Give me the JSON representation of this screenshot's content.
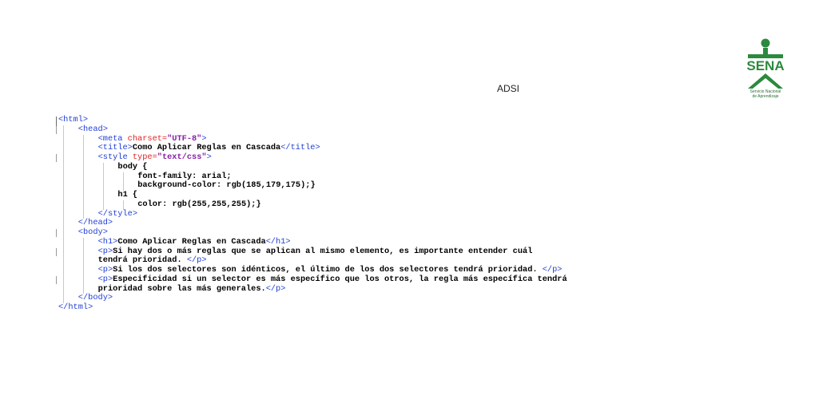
{
  "header": {
    "label": "ADSI",
    "logo": {
      "wordmark": "SENA",
      "subtitle_line1": "Servicio Nacional",
      "subtitle_line2": "de Aprendizaje",
      "color": "#2b8a3e"
    }
  },
  "colors": {
    "tag": "#1f3ed4",
    "attribute": "#e02020",
    "value": "#8a1fa8",
    "text": "#000000"
  },
  "code_lines": [
    {
      "indent": 0,
      "guides": false,
      "segments": [
        {
          "c": "t",
          "text": "<html>"
        }
      ]
    },
    {
      "indent": 4,
      "guides": true,
      "segments": [
        {
          "c": "t",
          "text": "<head>"
        }
      ]
    },
    {
      "indent": 8,
      "guides": false,
      "segments": [
        {
          "c": "t",
          "text": "<meta "
        },
        {
          "c": "a",
          "text": "charset="
        },
        {
          "c": "v",
          "text": "\"UTF-8\""
        },
        {
          "c": "t",
          "text": ">"
        }
      ]
    },
    {
      "indent": 8,
      "guides": false,
      "segments": [
        {
          "c": "t",
          "text": "<title>"
        },
        {
          "c": "x",
          "text": "Como Aplicar Reglas en Cascada"
        },
        {
          "c": "t",
          "text": "</title>"
        }
      ]
    },
    {
      "indent": 8,
      "guides": true,
      "segments": [
        {
          "c": "t",
          "text": "<style "
        },
        {
          "c": "a",
          "text": "type="
        },
        {
          "c": "v",
          "text": "\"text/css\""
        },
        {
          "c": "t",
          "text": ">"
        }
      ]
    },
    {
      "indent": 12,
      "guides": false,
      "segments": [
        {
          "c": "x",
          "text": "body {"
        }
      ]
    },
    {
      "indent": 16,
      "guides": false,
      "segments": [
        {
          "c": "x",
          "text": "font-family: arial;"
        }
      ]
    },
    {
      "indent": 16,
      "guides": false,
      "segments": [
        {
          "c": "x",
          "text": "background-color: rgb(185,179,175);}"
        }
      ]
    },
    {
      "indent": 12,
      "guides": false,
      "segments": [
        {
          "c": "x",
          "text": "h1 {"
        }
      ]
    },
    {
      "indent": 16,
      "guides": false,
      "segments": [
        {
          "c": "x",
          "text": "color: rgb(255,255,255);}"
        }
      ]
    },
    {
      "indent": 8,
      "guides": false,
      "segments": [
        {
          "c": "t",
          "text": "</style>"
        }
      ]
    },
    {
      "indent": 4,
      "guides": false,
      "segments": [
        {
          "c": "t",
          "text": "</head>"
        }
      ]
    },
    {
      "indent": 4,
      "guides": true,
      "segments": [
        {
          "c": "t",
          "text": "<body>"
        }
      ]
    },
    {
      "indent": 8,
      "guides": false,
      "segments": [
        {
          "c": "t",
          "text": "<h1>"
        },
        {
          "c": "x",
          "text": "Como Aplicar Reglas en Cascada"
        },
        {
          "c": "t",
          "text": "</h1>"
        }
      ]
    },
    {
      "indent": 8,
      "guides": true,
      "segments": [
        {
          "c": "t",
          "text": "<p>"
        },
        {
          "c": "x",
          "text": "Si hay dos o más reglas que se aplican al mismo elemento, es importante entender cuál"
        }
      ]
    },
    {
      "indent": 8,
      "guides": false,
      "segments": [
        {
          "c": "x",
          "text": "tendrá prioridad. "
        },
        {
          "c": "t",
          "text": "</p>"
        }
      ]
    },
    {
      "indent": 8,
      "guides": false,
      "segments": [
        {
          "c": "t",
          "text": "<p>"
        },
        {
          "c": "x",
          "text": "Si los dos selectores son idénticos, el último de los dos selectores tendrá prioridad. "
        },
        {
          "c": "t",
          "text": "</p>"
        }
      ]
    },
    {
      "indent": 8,
      "guides": true,
      "segments": [
        {
          "c": "t",
          "text": "<p>"
        },
        {
          "c": "x",
          "text": "Especificidad si un selector es más específico que los otros, la regla más específica tendrá"
        }
      ]
    },
    {
      "indent": 8,
      "guides": false,
      "segments": [
        {
          "c": "x",
          "text": "prioridad sobre las más generales."
        },
        {
          "c": "t",
          "text": "</p>"
        }
      ]
    },
    {
      "indent": 4,
      "guides": false,
      "segments": [
        {
          "c": "t",
          "text": "</body>"
        }
      ]
    },
    {
      "indent": 0,
      "guides": false,
      "segments": [
        {
          "c": "t",
          "text": "</html>"
        }
      ]
    }
  ]
}
